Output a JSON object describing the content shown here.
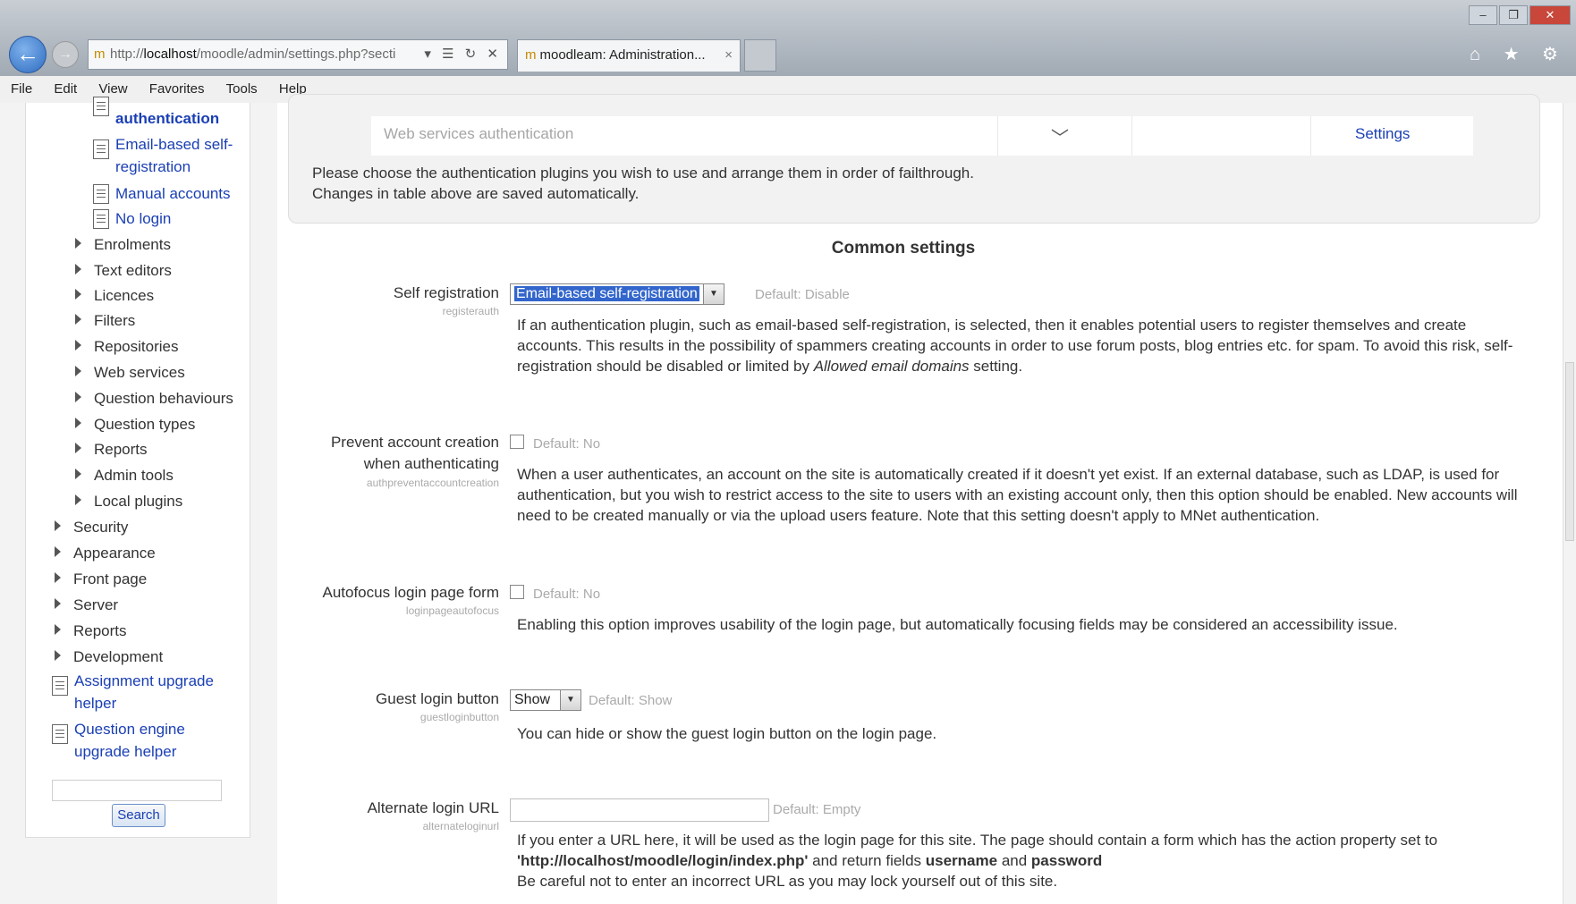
{
  "browser": {
    "address_prefix": "http://",
    "address_host": "localhost",
    "address_rest": "/moodle/admin/settings.php?secti",
    "address_controls": "▾ ☰ ↻ ✕",
    "tab_title": "moodleam: Administration...",
    "tab_close": "×",
    "window_controls": [
      "–",
      "❐",
      "✕"
    ],
    "toolbar_icons": "⌂ ★ ⚙"
  },
  "menubar": [
    "File",
    "Edit",
    "View",
    "Favorites",
    "Tools",
    "Help"
  ],
  "sidebar": {
    "manage_auth": "authentication",
    "email_based": "Email-based self-\nregistration",
    "email_based_1": "Email-based self-",
    "email_based_2": "registration",
    "manual_accounts": "Manual accounts",
    "no_login": "No login",
    "sub_items": [
      "Enrolments",
      "Text editors",
      "Licences",
      "Filters",
      "Repositories",
      "Web services",
      "Question behaviours",
      "Question types",
      "Reports",
      "Admin tools",
      "Local plugins"
    ],
    "top_items": [
      "Security",
      "Appearance",
      "Front page",
      "Server",
      "Reports",
      "Development"
    ],
    "assignment_1": "Assignment upgrade",
    "assignment_2": "helper",
    "question_1": "Question engine",
    "question_2": "upgrade helper",
    "search_button": "Search"
  },
  "auth_table": {
    "row_name": "Web services authentication",
    "row_arrow": "﹀",
    "row_settings": "Settings",
    "note_line1": "Please choose the authentication plugins you wish to use and arrange them in order of failthrough.",
    "note_line2": "Changes in table above are saved automatically."
  },
  "common_settings_title": "Common settings",
  "settings": {
    "selfreg": {
      "label": "Self registration",
      "key": "registerauth",
      "value": "Email-based self-registration",
      "default": "Default: Disable",
      "desc_pre": "If an authentication plugin, such as email-based self-registration, is selected, then it enables potential users to register themselves and create accounts. This results in the possibility of spammers creating accounts in order to use forum posts, blog entries etc. for spam. To avoid this risk, self-registration should be disabled or limited by ",
      "desc_em": "Allowed email domains",
      "desc_post": " setting."
    },
    "prevent": {
      "label_1": "Prevent account creation",
      "label_2": "when authenticating",
      "key": "authpreventaccountcreation",
      "default": "Default: No",
      "desc": "When a user authenticates, an account on the site is automatically created if it doesn't yet exist. If an external database, such as LDAP, is used for authentication, but you wish to restrict access to the site to users with an existing account only, then this option should be enabled. New accounts will need to be created manually or via the upload users feature. Note that this setting doesn't apply to MNet authentication."
    },
    "autofocus": {
      "label": "Autofocus login page form",
      "key": "loginpageautofocus",
      "default": "Default: No",
      "desc": "Enabling this option improves usability of the login page, but automatically focusing fields may be considered an accessibility issue."
    },
    "guest": {
      "label": "Guest login button",
      "key": "guestloginbutton",
      "value": "Show",
      "default": "Default: Show",
      "desc": "You can hide or show the guest login button on the login page."
    },
    "alternate": {
      "label": "Alternate login URL",
      "key": "alternateloginurl",
      "default": "Default: Empty",
      "desc_1": "If you enter a URL here, it will be used as the login page for this site. The page should contain a form which has the action property set to",
      "desc_url": "'http://localhost/moodle/login/index.php'",
      "desc_mid": " and return fields ",
      "desc_user": "username",
      "desc_and": " and ",
      "desc_pass": "password",
      "desc_2": "Be careful not to enter an incorrect URL as you may lock yourself out of this site."
    }
  }
}
